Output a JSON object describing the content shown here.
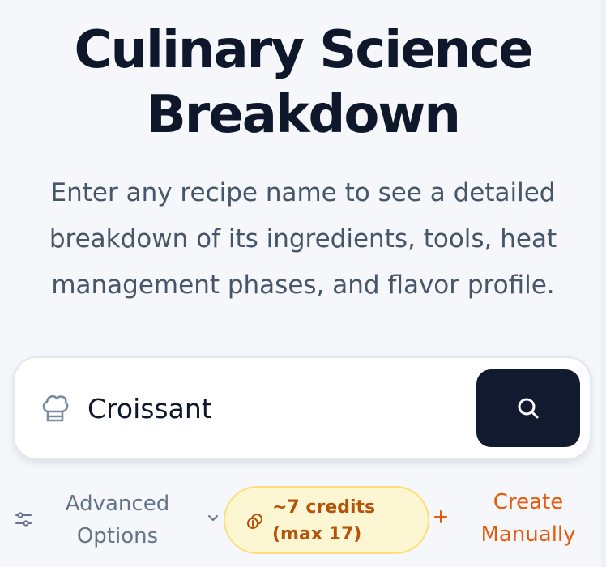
{
  "header": {
    "title_line1": "Culinary Science",
    "title_line2": "Breakdown",
    "subtitle_line1": "Enter any recipe name to see a detailed",
    "subtitle_line2": "breakdown of its ingredients, tools, heat",
    "subtitle_line3": "management phases, and flavor profile."
  },
  "search": {
    "value": "Croissant",
    "leading_icon": "chef-hat-icon",
    "button_icon": "search-icon"
  },
  "options": {
    "advanced_line1": "Advanced",
    "advanced_line2": "Options",
    "advanced_icon": "sliders-icon",
    "advanced_chevron": "chevron-down-icon",
    "credits_icon": "coins-icon",
    "credits_line1": "~7 credits",
    "credits_line2": "(max 17)",
    "plus_icon": "plus-icon",
    "create_line1": "Create",
    "create_line2": "Manually"
  },
  "colors": {
    "background": "#f5f7fa",
    "title": "#0f172a",
    "subtitle": "#475569",
    "search_button": "#111a2e",
    "credits_bg": "#fdf6d3",
    "credits_border": "#fbe07a",
    "credits_text": "#b45309",
    "accent_orange": "#ea580c"
  }
}
